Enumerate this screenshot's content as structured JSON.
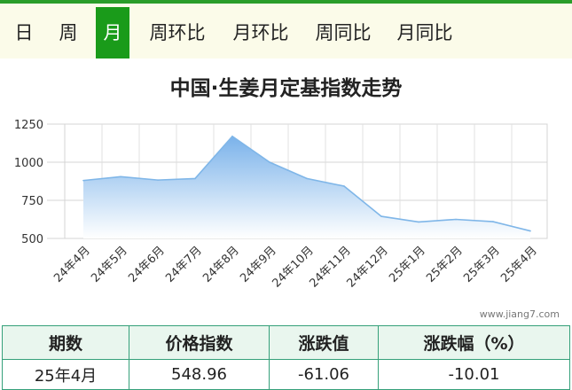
{
  "tabs": [
    {
      "label": "日",
      "active": false
    },
    {
      "label": "周",
      "active": false
    },
    {
      "label": "月",
      "active": true
    },
    {
      "label": "周环比",
      "active": false
    },
    {
      "label": "月环比",
      "active": false
    },
    {
      "label": "周同比",
      "active": false
    },
    {
      "label": "月同比",
      "active": false
    }
  ],
  "colors": {
    "accent": "#1a9b1a",
    "line": "#7fb6e8",
    "fill_top": "#7ab2ea",
    "fill_bottom": "#ffffff",
    "table_border": "#35a07a"
  },
  "watermark": "www.jiang7.com",
  "chart_data": {
    "type": "area",
    "title": "中国·生姜月定基指数走势",
    "categories": [
      "24年4月",
      "24年5月",
      "24年6月",
      "24年7月",
      "24年8月",
      "24年9月",
      "24年10月",
      "24年11月",
      "24年12月",
      "25年1月",
      "25年2月",
      "25年3月",
      "25年4月"
    ],
    "series": [
      {
        "values": [
          880,
          905,
          883,
          893,
          1170,
          1000,
          893,
          843,
          645,
          608,
          625,
          610,
          549
        ]
      }
    ],
    "yticks": [
      500,
      750,
      1000,
      1250
    ],
    "ylim": [
      500,
      1250
    ],
    "grid": true
  },
  "table": {
    "headers": [
      "期数",
      "价格指数",
      "涨跌值",
      "涨跌幅（%）"
    ],
    "row": [
      "25年4月",
      "548.96",
      "-61.06",
      "-10.01"
    ]
  }
}
